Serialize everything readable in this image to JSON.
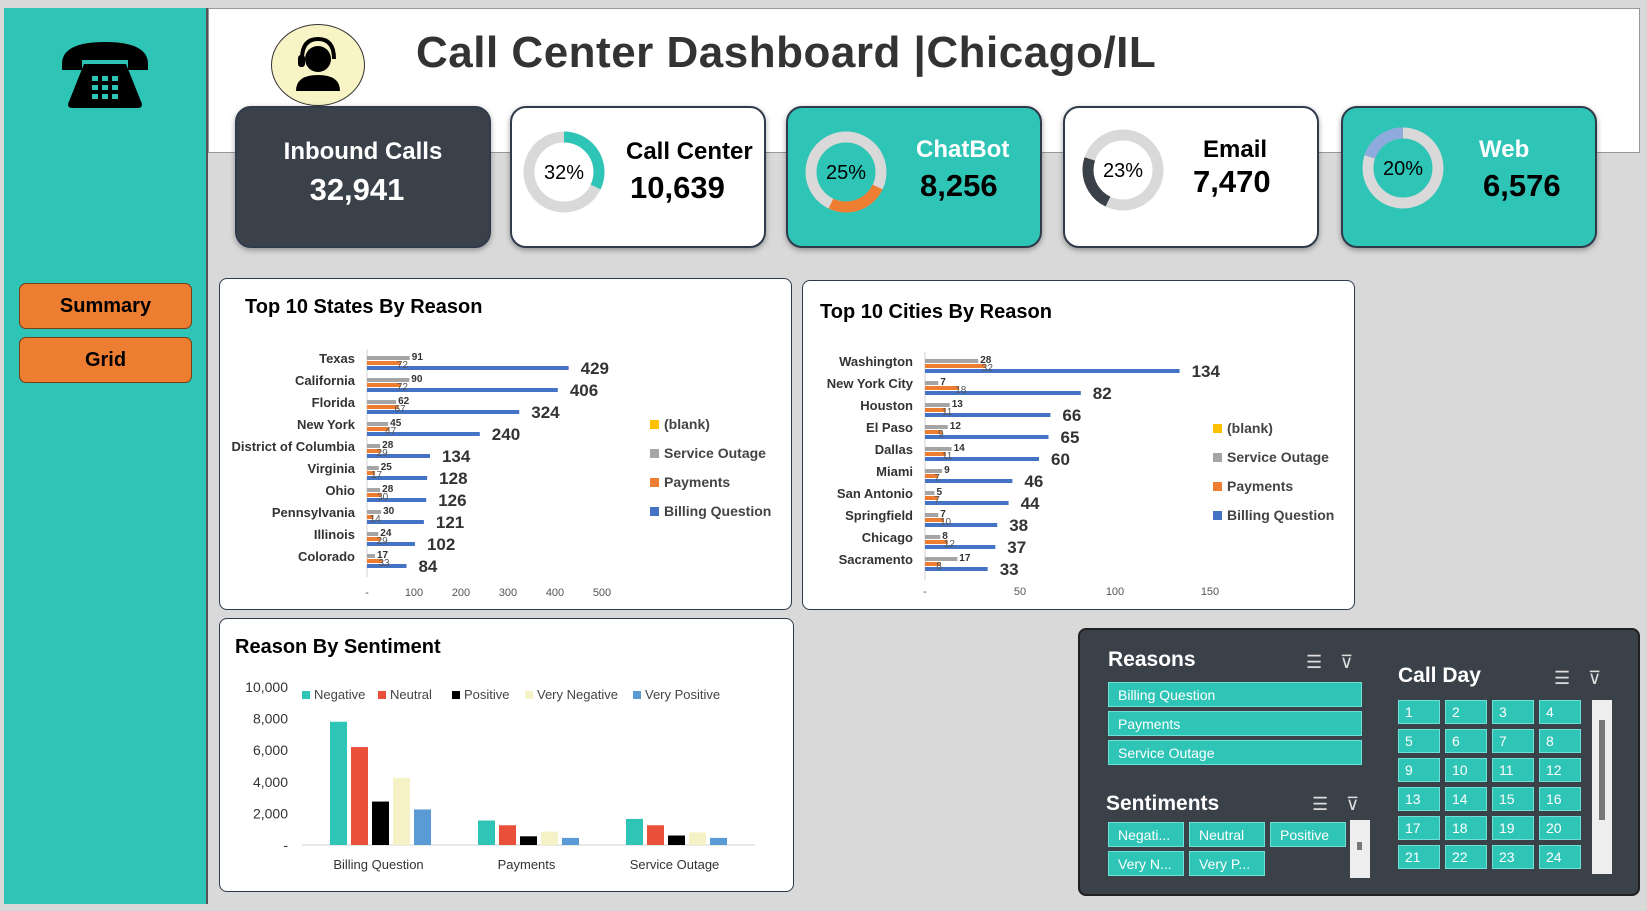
{
  "header": {
    "title": "Call Center Dashboard |Chicago/IL"
  },
  "nav": {
    "summary_label": "Summary",
    "grid_label": "Grid"
  },
  "kpis": {
    "inbound": {
      "label": "Inbound Calls",
      "value": "32,941"
    },
    "call_center": {
      "label": "Call Center",
      "value": "10,639",
      "pct": "32%",
      "fraction": 0.32
    },
    "chatbot": {
      "label": "ChatBot",
      "value": "8,256",
      "pct": "25%",
      "fraction": 0.25
    },
    "email": {
      "label": "Email",
      "value": "7,470",
      "pct": "23%",
      "fraction": 0.23
    },
    "web": {
      "label": "Web",
      "value": "6,576",
      "pct": "20%",
      "fraction": 0.2
    }
  },
  "colors": {
    "teal": "#2ec4b6",
    "dark": "#3a4149",
    "orange": "#ed7d31",
    "blue": "#4472c4",
    "gray": "#a5a5a5",
    "yellow": "#ffc000",
    "red": "#e8503a",
    "cream": "#f5f2c8",
    "light_blue": "#5b9bd5"
  },
  "chart_data": [
    {
      "type": "bar",
      "title": "Top 10 States By Reason",
      "categories": [
        "Texas",
        "California",
        "Florida",
        "New York",
        "District of Columbia",
        "Virginia",
        "Ohio",
        "Pennsylvania",
        "Illinois",
        "Colorado"
      ],
      "series": [
        {
          "name": "(blank)",
          "values": [
            0,
            0,
            0,
            0,
            0,
            0,
            0,
            0,
            0,
            0
          ]
        },
        {
          "name": "Service Outage",
          "values": [
            91,
            90,
            62,
            45,
            28,
            25,
            28,
            30,
            24,
            17
          ]
        },
        {
          "name": "Payments",
          "values": [
            72,
            72,
            67,
            47,
            29,
            17,
            30,
            14,
            29,
            33
          ]
        },
        {
          "name": "Billing Question",
          "values": [
            429,
            406,
            324,
            240,
            134,
            128,
            126,
            121,
            102,
            84
          ]
        }
      ],
      "xticks": [
        "-",
        "100",
        "200",
        "300",
        "400",
        "500"
      ],
      "xlim": [
        0,
        500
      ],
      "legend": "right"
    },
    {
      "type": "bar",
      "title": "Top 10 Cities By Reason",
      "categories": [
        "Washington",
        "New York City",
        "Houston",
        "El Paso",
        "Dallas",
        "Miami",
        "San Antonio",
        "Springfield",
        "Chicago",
        "Sacramento"
      ],
      "series": [
        {
          "name": "(blank)",
          "values": [
            0,
            0,
            0,
            0,
            0,
            0,
            0,
            0,
            0,
            0
          ]
        },
        {
          "name": "Service Outage",
          "values": [
            28,
            7,
            13,
            12,
            14,
            9,
            5,
            7,
            8,
            17
          ]
        },
        {
          "name": "Payments",
          "values": [
            32,
            18,
            11,
            9,
            11,
            7,
            7,
            10,
            12,
            8
          ]
        },
        {
          "name": "Billing Question",
          "values": [
            134,
            82,
            66,
            65,
            60,
            46,
            44,
            38,
            37,
            33
          ]
        }
      ],
      "xticks": [
        "-",
        "50",
        "100",
        "150"
      ],
      "xlim": [
        0,
        150
      ],
      "legend": "right"
    },
    {
      "type": "bar",
      "title": "Reason By Sentiment",
      "categories": [
        "Billing Question",
        "Payments",
        "Service Outage"
      ],
      "series": [
        {
          "name": "Negative",
          "values": [
            7800,
            1550,
            1650
          ]
        },
        {
          "name": "Neutral",
          "values": [
            6200,
            1250,
            1250
          ]
        },
        {
          "name": "Positive",
          "values": [
            2750,
            550,
            600
          ]
        },
        {
          "name": "Very Negative",
          "values": [
            4250,
            850,
            800
          ]
        },
        {
          "name": "Very Positive",
          "values": [
            2250,
            450,
            450
          ]
        }
      ],
      "yticks": [
        "10,000",
        "8,000",
        "6,000",
        "4,000",
        "2,000",
        "-"
      ],
      "ylim": [
        0,
        10000
      ],
      "legend": "top"
    }
  ],
  "slicers": {
    "reasons": {
      "title": "Reasons",
      "items": [
        "Billing Question",
        "Payments",
        "Service Outage"
      ]
    },
    "sentiments": {
      "title": "Sentiments",
      "items": [
        "Negati...",
        "Neutral",
        "Positive",
        "Very N...",
        "Very P..."
      ]
    },
    "call_day": {
      "title": "Call Day",
      "days": [
        "1",
        "2",
        "3",
        "4",
        "5",
        "6",
        "7",
        "8",
        "9",
        "10",
        "11",
        "12",
        "13",
        "14",
        "15",
        "16",
        "17",
        "18",
        "19",
        "20",
        "21",
        "22",
        "23",
        "24"
      ]
    }
  }
}
